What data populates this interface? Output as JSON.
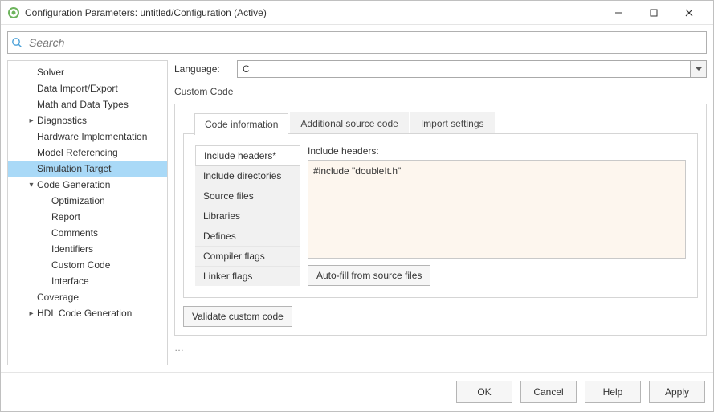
{
  "window": {
    "title": "Configuration Parameters: untitled/Configuration (Active)"
  },
  "search": {
    "placeholder": "Search"
  },
  "sidebar": {
    "items": [
      {
        "label": "Solver",
        "indent": 1,
        "arrow": ""
      },
      {
        "label": "Data Import/Export",
        "indent": 1,
        "arrow": ""
      },
      {
        "label": "Math and Data Types",
        "indent": 1,
        "arrow": ""
      },
      {
        "label": "Diagnostics",
        "indent": 1,
        "arrow": "▸"
      },
      {
        "label": "Hardware Implementation",
        "indent": 1,
        "arrow": ""
      },
      {
        "label": "Model Referencing",
        "indent": 1,
        "arrow": ""
      },
      {
        "label": "Simulation Target",
        "indent": 1,
        "arrow": "",
        "selected": true
      },
      {
        "label": "Code Generation",
        "indent": 1,
        "arrow": "▾"
      },
      {
        "label": "Optimization",
        "indent": 2,
        "arrow": ""
      },
      {
        "label": "Report",
        "indent": 2,
        "arrow": ""
      },
      {
        "label": "Comments",
        "indent": 2,
        "arrow": ""
      },
      {
        "label": "Identifiers",
        "indent": 2,
        "arrow": ""
      },
      {
        "label": "Custom Code",
        "indent": 2,
        "arrow": ""
      },
      {
        "label": "Interface",
        "indent": 2,
        "arrow": ""
      },
      {
        "label": "Coverage",
        "indent": 1,
        "arrow": ""
      },
      {
        "label": "HDL Code Generation",
        "indent": 1,
        "arrow": "▸"
      }
    ]
  },
  "main": {
    "language_label": "Language:",
    "language_value": "C",
    "custom_code_label": "Custom Code",
    "tabs": [
      {
        "label": "Code information",
        "active": true
      },
      {
        "label": "Additional source code",
        "active": false
      },
      {
        "label": "Import settings",
        "active": false
      }
    ],
    "left_items": [
      {
        "label": "Include headers*",
        "selected": true
      },
      {
        "label": "Include directories"
      },
      {
        "label": "Source files"
      },
      {
        "label": "Libraries"
      },
      {
        "label": "Defines"
      },
      {
        "label": "Compiler flags"
      },
      {
        "label": "Linker flags"
      }
    ],
    "include_headers_label": "Include headers:",
    "include_headers_value": "#include \"doubleIt.h\"",
    "autofill_label": "Auto-fill from source files",
    "validate_label": "Validate custom code",
    "ellipsis": "…"
  },
  "footer": {
    "ok": "OK",
    "cancel": "Cancel",
    "help": "Help",
    "apply": "Apply"
  }
}
